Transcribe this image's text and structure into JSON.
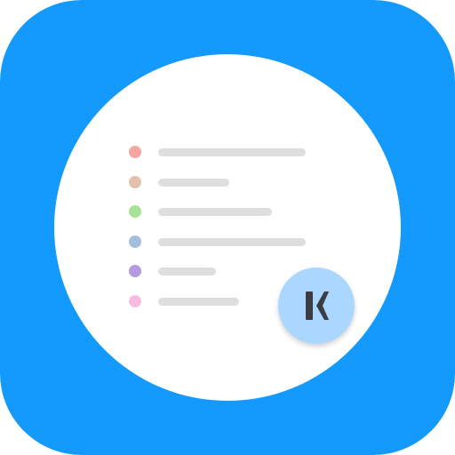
{
  "app_icon": {
    "background_color": "#1499fd",
    "disc_color": "#ffffff",
    "line_color": "#dedede",
    "badge": {
      "icon": "k-logo-icon",
      "background_color": "#aad7ff",
      "glyph_color": "#3a3d44"
    },
    "list_items": [
      {
        "dot_color": "#f6a5a5",
        "line_length": 1.0
      },
      {
        "dot_color": "#e2c2ad",
        "line_length": 0.48
      },
      {
        "dot_color": "#a8e19a",
        "line_length": 0.77
      },
      {
        "dot_color": "#a3bedb",
        "line_length": 1.0
      },
      {
        "dot_color": "#b49ae0",
        "line_length": 0.39
      },
      {
        "dot_color": "#f9bde0",
        "line_length": 0.55
      }
    ]
  }
}
